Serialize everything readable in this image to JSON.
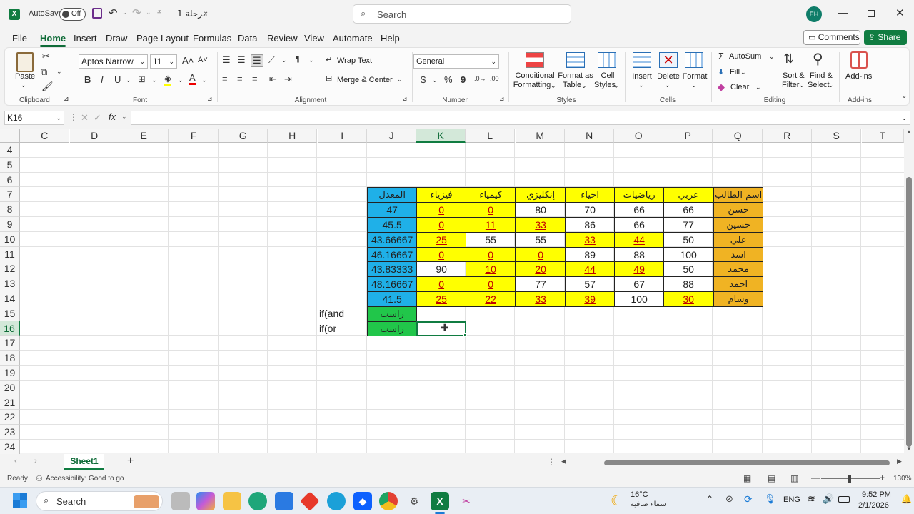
{
  "titlebar": {
    "autosave_label": "AutoSave",
    "autosave_state": "Off",
    "filename": "مرحلة 1",
    "search_placeholder": "Search",
    "user_initials": "EH"
  },
  "menu": {
    "tabs": [
      "File",
      "Home",
      "Insert",
      "Draw",
      "Page Layout",
      "Formulas",
      "Data",
      "Review",
      "View",
      "Automate",
      "Help"
    ],
    "comments": "Comments",
    "share": "Share"
  },
  "ribbon": {
    "clipboard": {
      "paste": "Paste",
      "group": "Clipboard"
    },
    "font": {
      "name": "Aptos Narrow",
      "size": "11",
      "group": "Font",
      "bold": "B",
      "italic": "I",
      "underline": "U"
    },
    "alignment": {
      "wrap": "Wrap Text",
      "merge": "Merge & Center",
      "group": "Alignment"
    },
    "number": {
      "format": "General",
      "group": "Number",
      "currency": "$",
      "percent": "%",
      "comma": "9"
    },
    "styles": {
      "conditional_1": "Conditional",
      "conditional_2": "Formatting",
      "format_table_1": "Format as",
      "format_table_2": "Table",
      "cell_styles_1": "Cell",
      "cell_styles_2": "Styles",
      "group": "Styles"
    },
    "cells": {
      "insert": "Insert",
      "delete": "Delete",
      "format": "Format",
      "group": "Cells"
    },
    "editing": {
      "autosum": "AutoSum",
      "fill": "Fill",
      "clear": "Clear",
      "sort_1": "Sort &",
      "sort_2": "Filter",
      "find_1": "Find &",
      "find_2": "Select",
      "group": "Editing"
    },
    "addins": {
      "label": "Add-ins",
      "group": "Add-ins"
    }
  },
  "formula_bar": {
    "name_box": "K16",
    "fx": "fx",
    "content": ""
  },
  "columns": [
    "C",
    "D",
    "E",
    "F",
    "G",
    "H",
    "I",
    "J",
    "K",
    "L",
    "M",
    "N",
    "O",
    "P",
    "Q",
    "R",
    "S",
    "T"
  ],
  "selected_column": "K",
  "rows": [
    "4",
    "5",
    "6",
    "7",
    "8",
    "9",
    "10",
    "11",
    "12",
    "13",
    "14",
    "15",
    "16",
    "17",
    "18",
    "19",
    "20",
    "21",
    "22",
    "23",
    "24"
  ],
  "selected_row": "16",
  "table": {
    "headers": {
      "J": "المعدل",
      "K": "فيزياء",
      "L": "كيمياء",
      "M": "إنكليزي",
      "N": "احياء",
      "O": "رياضيات",
      "P": "عربي",
      "Q": "اسم الطالب"
    },
    "rows": [
      {
        "J": "47",
        "K": "0",
        "L": "0",
        "M": "80",
        "N": "70",
        "O": "66",
        "P": "66",
        "Q": "حسن"
      },
      {
        "J": "45.5",
        "K": "0",
        "L": "11",
        "M": "33",
        "N": "86",
        "O": "66",
        "P": "77",
        "Q": "حسين"
      },
      {
        "J": "43.66667",
        "K": "25",
        "L": "55",
        "M": "55",
        "N": "33",
        "O": "44",
        "P": "50",
        "Q": "علي"
      },
      {
        "J": "46.16667",
        "K": "0",
        "L": "0",
        "M": "0",
        "N": "89",
        "O": "88",
        "P": "100",
        "Q": "اسد"
      },
      {
        "J": "43.83333",
        "K": "90",
        "L": "10",
        "M": "20",
        "N": "44",
        "O": "49",
        "P": "50",
        "Q": "محمد"
      },
      {
        "J": "48.16667",
        "K": "0",
        "L": "0",
        "M": "77",
        "N": "57",
        "O": "67",
        "P": "88",
        "Q": "احمد"
      },
      {
        "J": "41.5",
        "K": "25",
        "L": "22",
        "M": "33",
        "N": "39",
        "O": "100",
        "P": "30",
        "Q": "وسام"
      }
    ]
  },
  "extra": {
    "i15": "if(and",
    "i16": "if(or",
    "j15": "راسب",
    "j16": "راسب"
  },
  "sheet_tabs": {
    "active": "Sheet1",
    "add": "+"
  },
  "status": {
    "ready": "Ready",
    "accessibility": "Accessibility: Good to go",
    "zoom": "130%"
  },
  "taskbar": {
    "search": "Search",
    "weather_temp": "16°C",
    "weather_desc": "سماء صافية",
    "lang": "ENG",
    "time": "9:52 PM",
    "date": "2/1/2026"
  }
}
